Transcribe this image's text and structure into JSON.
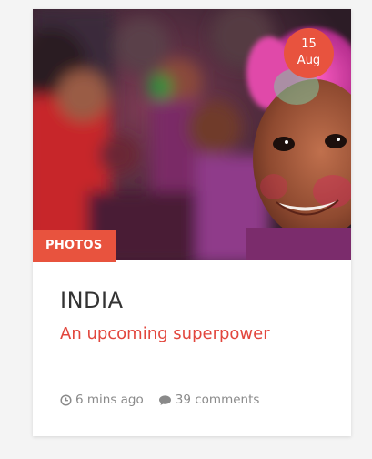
{
  "post": {
    "date": {
      "day": "15",
      "month": "Aug"
    },
    "category": "PHOTOS",
    "title": "INDIA",
    "subtitle": "An upcoming superpower",
    "meta": {
      "time": "6 mins ago",
      "comments": "39 comments"
    }
  },
  "icons": {
    "time": "clock-icon",
    "comments": "comment-bubble-icon"
  },
  "colors": {
    "accent": "#e8533e",
    "subtitle": "#e2463d",
    "title": "#333333",
    "meta": "#8a8a8a"
  }
}
